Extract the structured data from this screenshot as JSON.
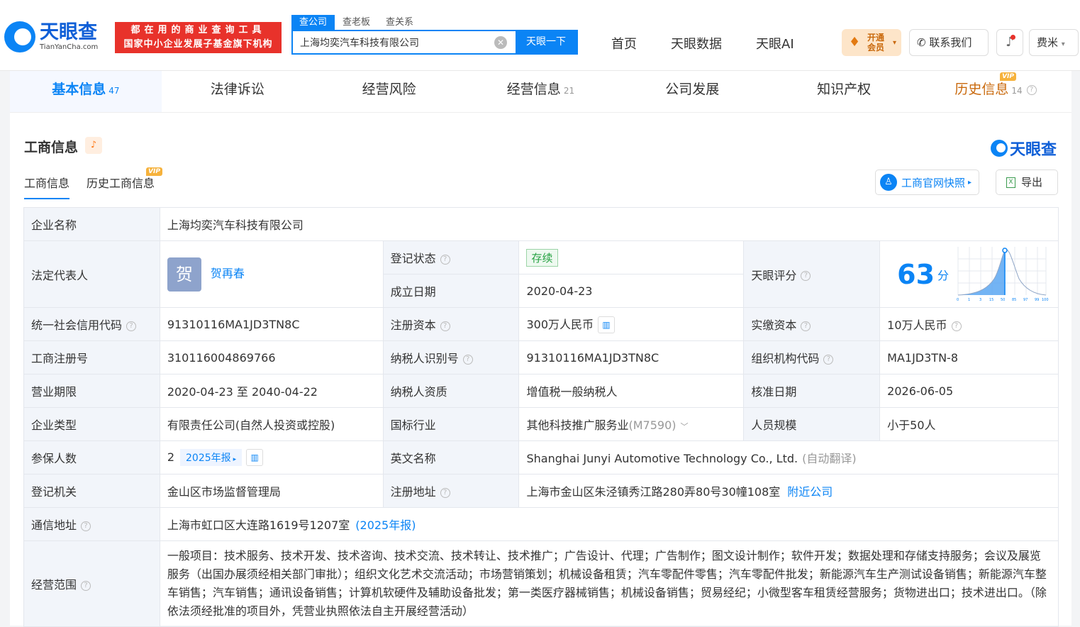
{
  "header": {
    "logo_cn": "天眼查",
    "logo_en": "TianYanCha.com",
    "promo_line1": "都在用的商业查询工具",
    "promo_line2": "国家中小企业发展子基金旗下机构",
    "search_tabs": [
      "查公司",
      "查老板",
      "查关系"
    ],
    "search_value": "上海均奕汽车科技有限公司",
    "search_button": "天眼一下",
    "nav": [
      "首页",
      "天眼数据",
      "天眼AI"
    ],
    "vip_button": "开通会员",
    "contact": "联系我们",
    "user": "费米"
  },
  "main_tabs": [
    {
      "label": "基本信息",
      "count": "47"
    },
    {
      "label": "法律诉讼",
      "count": ""
    },
    {
      "label": "经营风险",
      "count": ""
    },
    {
      "label": "经营信息",
      "count": "21"
    },
    {
      "label": "公司发展",
      "count": ""
    },
    {
      "label": "知识产权",
      "count": ""
    },
    {
      "label": "历史信息",
      "count": "14"
    }
  ],
  "section": {
    "title": "工商信息",
    "brand": "天眼查",
    "subtabs": [
      "工商信息",
      "历史工商信息"
    ],
    "vip_badge": "VIP",
    "snapshot_button": "工商官网快照",
    "export_button": "导出"
  },
  "info": {
    "company_name_label": "企业名称",
    "company_name": "上海均奕汽车科技有限公司",
    "legal_rep_label": "法定代表人",
    "legal_rep_avatar": "贺",
    "legal_rep": "贺再春",
    "reg_status_label": "登记状态",
    "reg_status": "存续",
    "found_date_label": "成立日期",
    "found_date": "2020-04-23",
    "score_label": "天眼评分",
    "score": "63",
    "score_unit": "分",
    "score_axis": [
      "0",
      "1",
      "3",
      "15",
      "50",
      "85",
      "97",
      "99",
      "100"
    ],
    "credit_code_label": "统一社会信用代码",
    "credit_code": "91310116MA1JD3TN8C",
    "reg_capital_label": "注册资本",
    "reg_capital": "300万人民币",
    "paid_capital_label": "实缴资本",
    "paid_capital": "10万人民币",
    "reg_no_label": "工商注册号",
    "reg_no": "310116004869766",
    "taxpayer_id_label": "纳税人识别号",
    "taxpayer_id": "91310116MA1JD3TN8C",
    "org_code_label": "组织机构代码",
    "org_code": "MA1JD3TN-8",
    "term_label": "营业期限",
    "term": "2020-04-23 至 2040-04-22",
    "taxpayer_qual_label": "纳税人资质",
    "taxpayer_qual": "增值税一般纳税人",
    "approve_date_label": "核准日期",
    "approve_date": "2026-06-05",
    "type_label": "企业类型",
    "type": "有限责任公司(自然人投资或控股)",
    "industry_label": "国标行业",
    "industry": "其他科技推广服务业",
    "industry_code": "(M7590)",
    "staff_size_label": "人员规模",
    "staff_size": "小于50人",
    "insured_label": "参保人数",
    "insured": "2",
    "insured_year": "2025年报",
    "english_name_label": "英文名称",
    "english_name": "Shanghai Junyi Automotive Technology Co., Ltd.",
    "english_name_note": "(自动翻译)",
    "authority_label": "登记机关",
    "authority": "金山区市场监督管理局",
    "reg_address_label": "注册地址",
    "reg_address": "上海市金山区朱泾镇秀江路280弄80号30幢108室",
    "nearby_link": "附近公司",
    "mail_address_label": "通信地址",
    "mail_address": "上海市虹口区大连路1619号1207室",
    "mail_address_year": "(2025年报)",
    "scope_label": "经营范围",
    "scope": "一般项目：技术服务、技术开发、技术咨询、技术交流、技术转让、技术推广；广告设计、代理；广告制作；图文设计制作；软件开发；数据处理和存储支持服务；会议及展览服务（出国办展须经相关部门审批）；组织文化艺术交流活动；市场营销策划；机械设备租赁；汽车零配件零售；汽车零配件批发；新能源汽车生产测试设备销售；新能源汽车整车销售；汽车销售；通讯设备销售；计算机软硬件及辅助设备批发；第一类医疗器械销售；机械设备销售；贸易经纪；小微型客车租赁经营服务；货物进出口；技术进出口。（除依法须经批准的项目外，凭营业执照依法自主开展经营活动）"
  },
  "colors": {
    "accent": "#0b84f5",
    "promo": "#e8322b",
    "gold": "#c9690c",
    "label_bg": "#f2f5fa"
  }
}
